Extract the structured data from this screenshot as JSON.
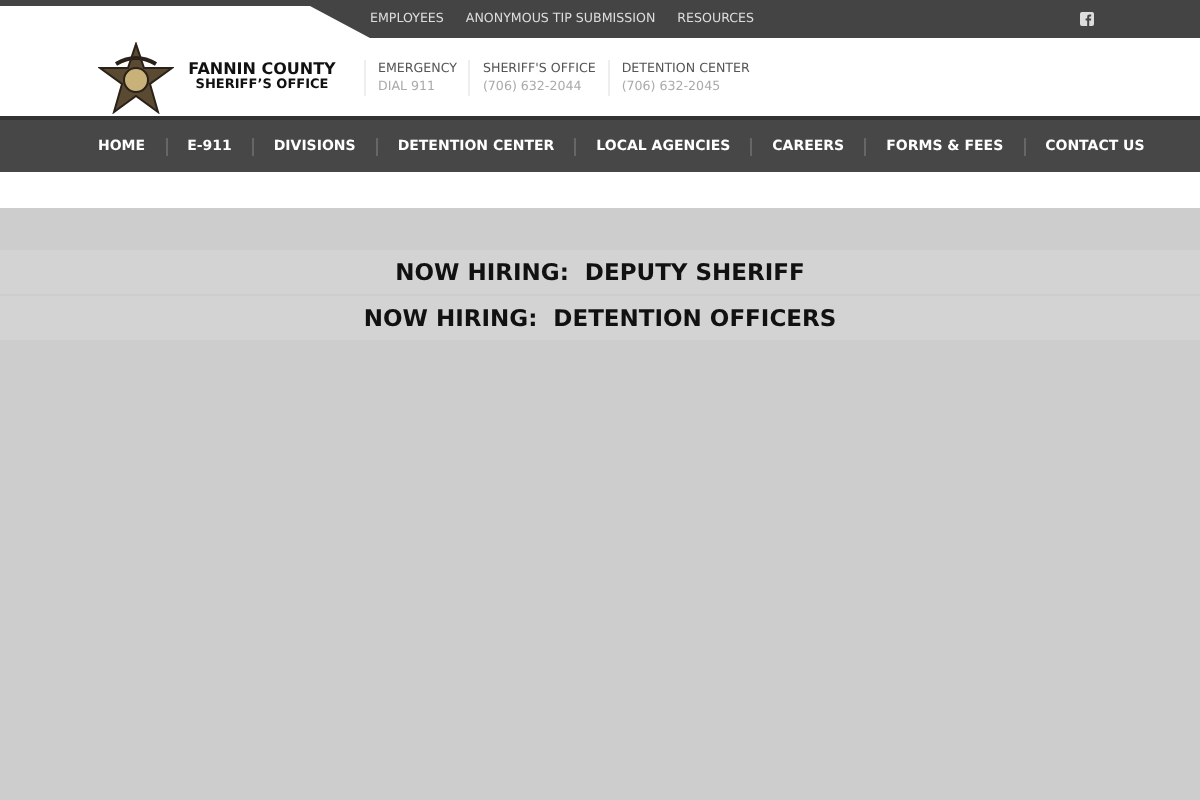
{
  "top_links": [
    "EMPLOYEES",
    "ANONYMOUS TIP SUBMISSION",
    "RESOURCES"
  ],
  "logo": {
    "line1": "FANNIN COUNTY",
    "line2": "SHERIFF’S OFFICE"
  },
  "contacts": [
    {
      "label": "EMERGENCY",
      "value": "DIAL 911"
    },
    {
      "label": "SHERIFF'S OFFICE",
      "value": "(706) 632-2044"
    },
    {
      "label": "DETENTION CENTER",
      "value": "(706) 632-2045"
    }
  ],
  "nav": [
    "HOME",
    "E-911",
    "DIVISIONS",
    "DETENTION CENTER",
    "LOCAL AGENCIES",
    "CAREERS",
    "FORMS & FEES",
    "CONTACT US"
  ],
  "announcements": [
    "NOW HIRING:  DEPUTY SHERIFF",
    "NOW HIRING:  DETENTION OFFICERS"
  ]
}
